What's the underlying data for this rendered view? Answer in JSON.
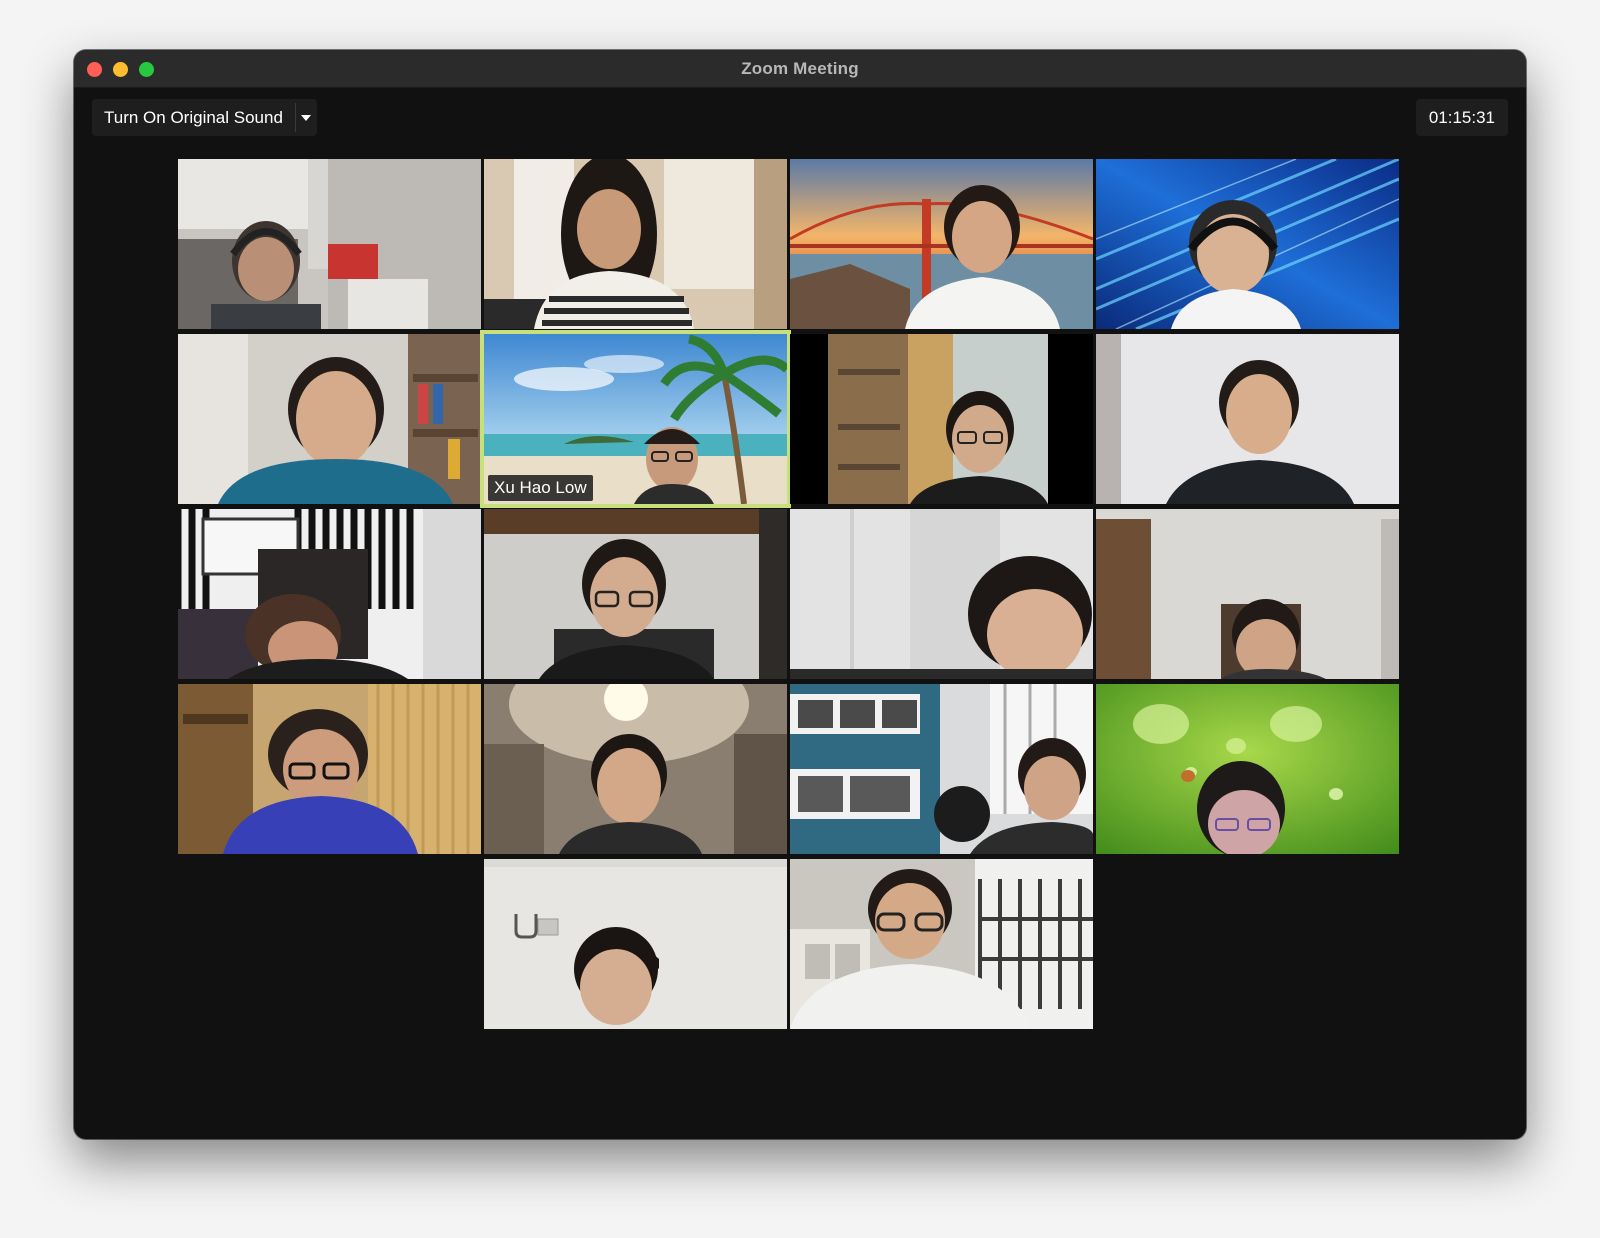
{
  "window": {
    "title": "Zoom Meeting"
  },
  "toolbar": {
    "original_sound_label": "Turn On Original Sound"
  },
  "timer": "01:15:31",
  "active_speaker": "Xu Hao Low",
  "theme": {
    "background": "#111111",
    "active_outline": "#c6e17a"
  },
  "participants_rows": [
    4,
    4,
    4,
    4,
    2
  ]
}
